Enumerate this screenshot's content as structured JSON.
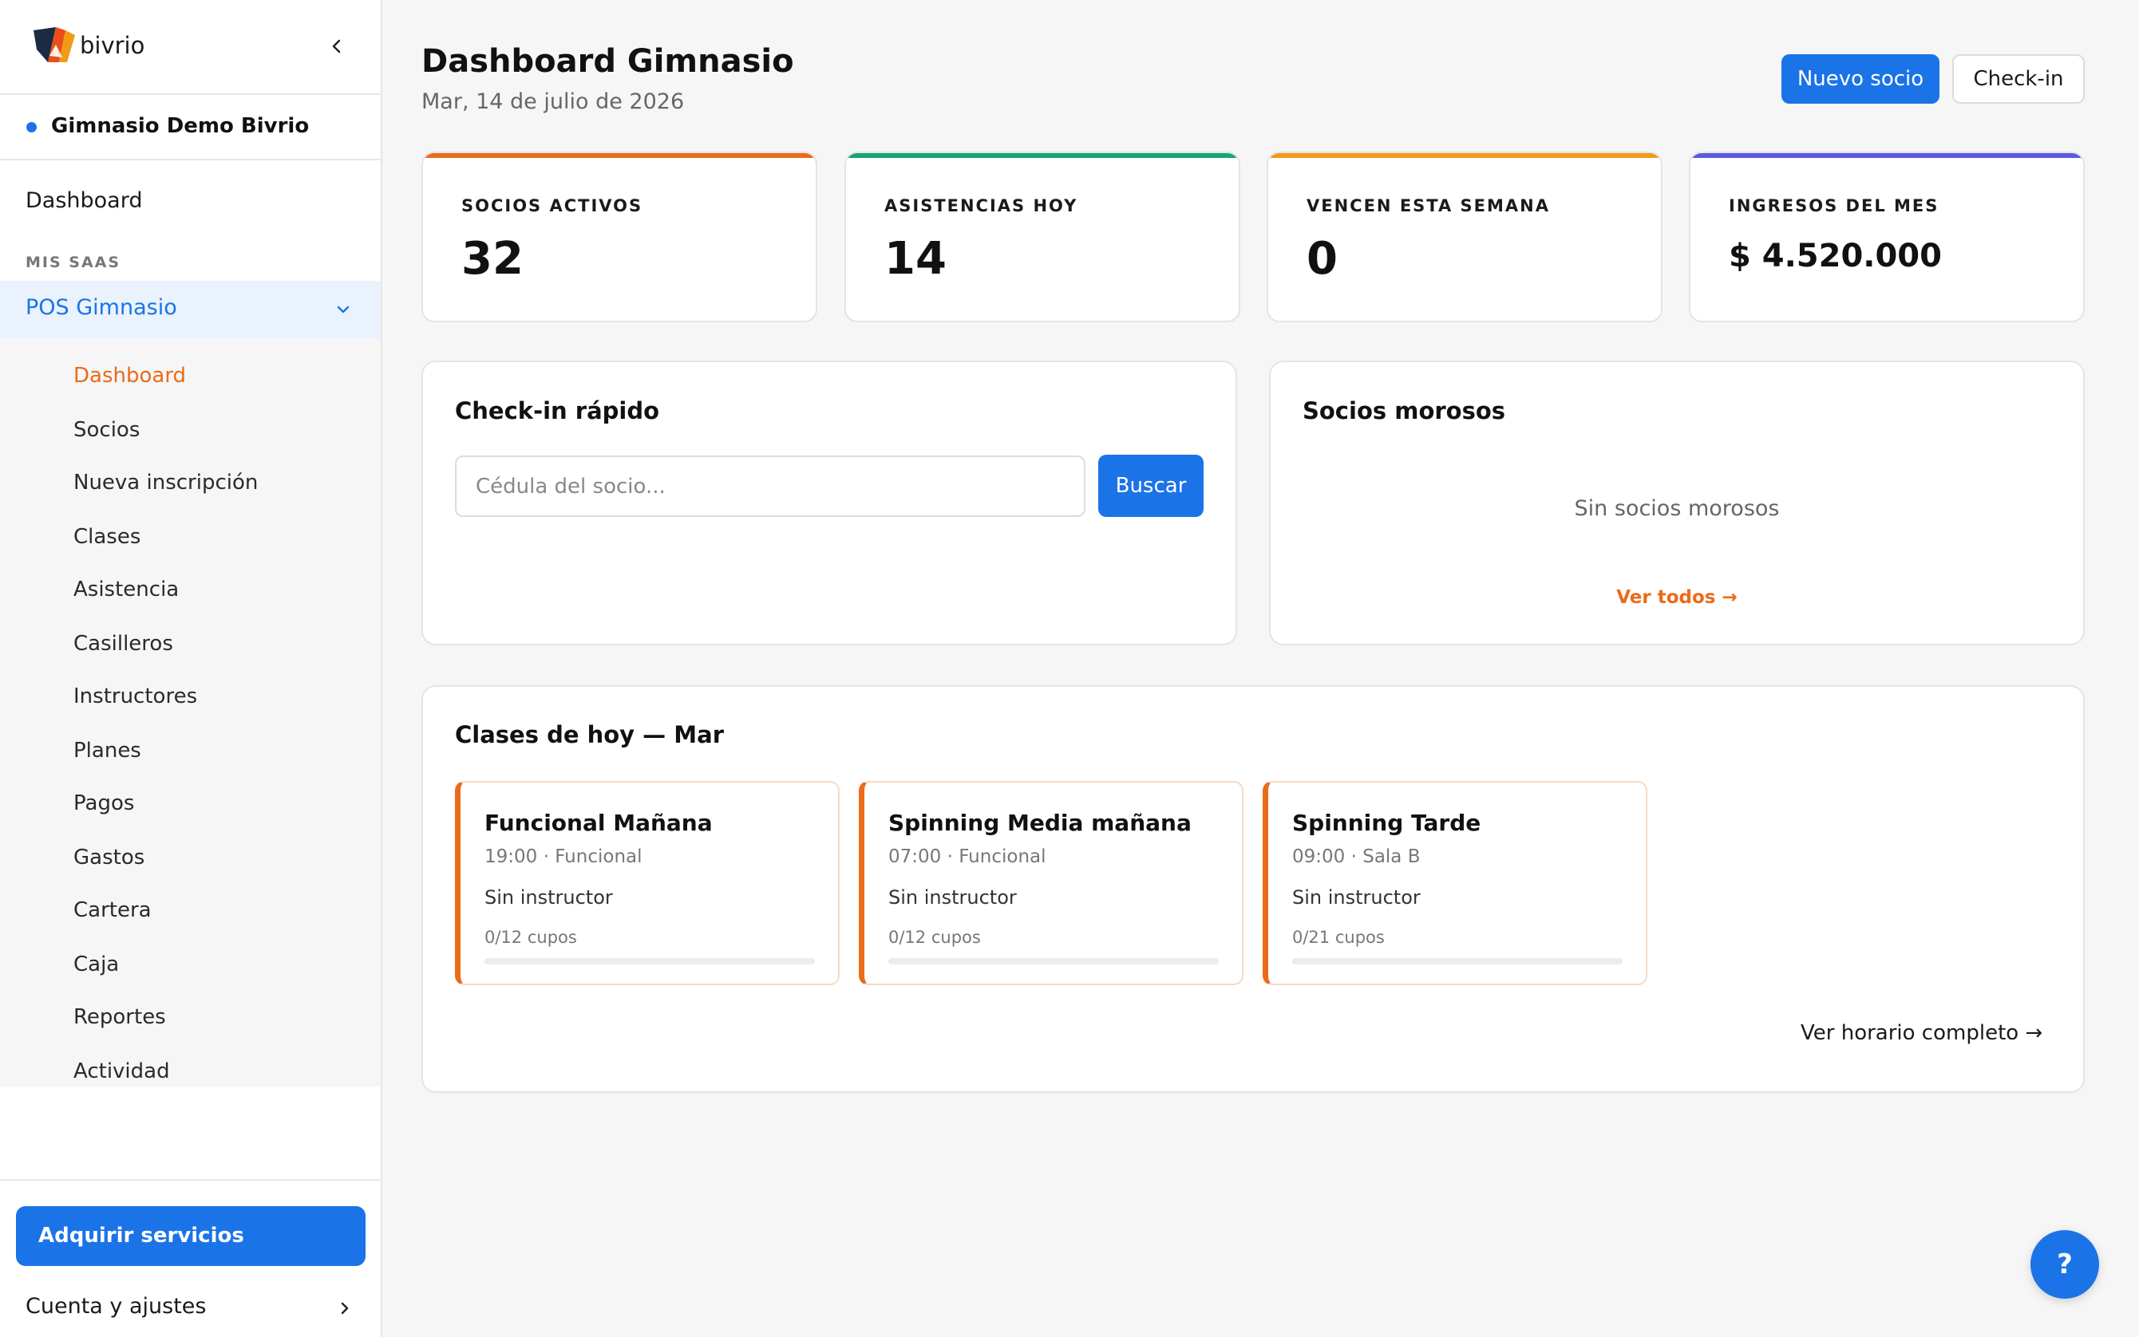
{
  "brand": {
    "name": "bivrio",
    "logo_icon": "bivrio-logo"
  },
  "workspace": {
    "name": "Gimnasio Demo Bivrio"
  },
  "sidebar": {
    "dashboard_label": "Dashboard",
    "section_label": "MIS SAAS",
    "saas_group_label": "POS Gimnasio",
    "items": [
      {
        "label": "Dashboard"
      },
      {
        "label": "Socios"
      },
      {
        "label": "Nueva inscripción"
      },
      {
        "label": "Clases"
      },
      {
        "label": "Asistencia"
      },
      {
        "label": "Casilleros"
      },
      {
        "label": "Instructores"
      },
      {
        "label": "Planes"
      },
      {
        "label": "Pagos"
      },
      {
        "label": "Gastos"
      },
      {
        "label": "Cartera"
      },
      {
        "label": "Caja"
      },
      {
        "label": "Reportes"
      },
      {
        "label": "Actividad"
      }
    ],
    "acquire_label": "Adquirir servicios",
    "account_label": "Cuenta y ajustes"
  },
  "header": {
    "title": "Dashboard Gimnasio",
    "date": "Mar, 14 de julio de 2026",
    "new_member_label": "Nuevo socio",
    "checkin_label": "Check-in"
  },
  "kpis": [
    {
      "label": "SOCIOS ACTIVOS",
      "value": "32",
      "color": "#ea6b1a"
    },
    {
      "label": "ASISTENCIAS HOY",
      "value": "14",
      "color": "#17a673"
    },
    {
      "label": "VENCEN ESTA SEMANA",
      "value": "0",
      "color": "#f29a17"
    },
    {
      "label": "INGRESOS DEL MES",
      "value": "$ 4.520.000",
      "color": "#5b5be0"
    }
  ],
  "quick_checkin": {
    "title": "Check-in rápido",
    "placeholder": "Cédula del socio...",
    "value": "",
    "search_label": "Buscar"
  },
  "debtors": {
    "title": "Socios morosos",
    "empty_text": "Sin socios morosos",
    "link_label": "Ver todos →"
  },
  "classes": {
    "title": "Clases de hoy — Mar",
    "items": [
      {
        "name": "Funcional Mañana",
        "meta": "19:00 · Funcional",
        "instructor": "Sin instructor",
        "capacity": "0/12 cupos",
        "fill_fraction": 0
      },
      {
        "name": "Spinning Media mañana",
        "meta": "07:00 · Funcional",
        "instructor": "Sin instructor",
        "capacity": "0/12 cupos",
        "fill_fraction": 0
      },
      {
        "name": "Spinning Tarde",
        "meta": "09:00 · Sala B",
        "instructor": "Sin instructor",
        "capacity": "0/21 cupos",
        "fill_fraction": 0
      }
    ],
    "link_label": "Ver horario completo →"
  },
  "help": {
    "label": "?"
  },
  "colors": {
    "primary": "#1b73e8",
    "accent": "#ea6b1a"
  }
}
